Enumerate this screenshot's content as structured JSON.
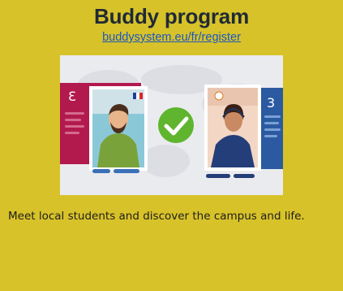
{
  "card": {
    "title": "Buddy program",
    "link_text": "buddysystem.eu/fr/register",
    "description": "Meet local students and discover the campus and life."
  },
  "illustration": {
    "left_profile_badge": "3",
    "right_profile_badge": "3"
  },
  "colors": {
    "background": "#d8c229",
    "link": "#1a57c2",
    "left_card": "#b21a4d",
    "right_card": "#2b5aa0",
    "check": "#5fb52e"
  }
}
